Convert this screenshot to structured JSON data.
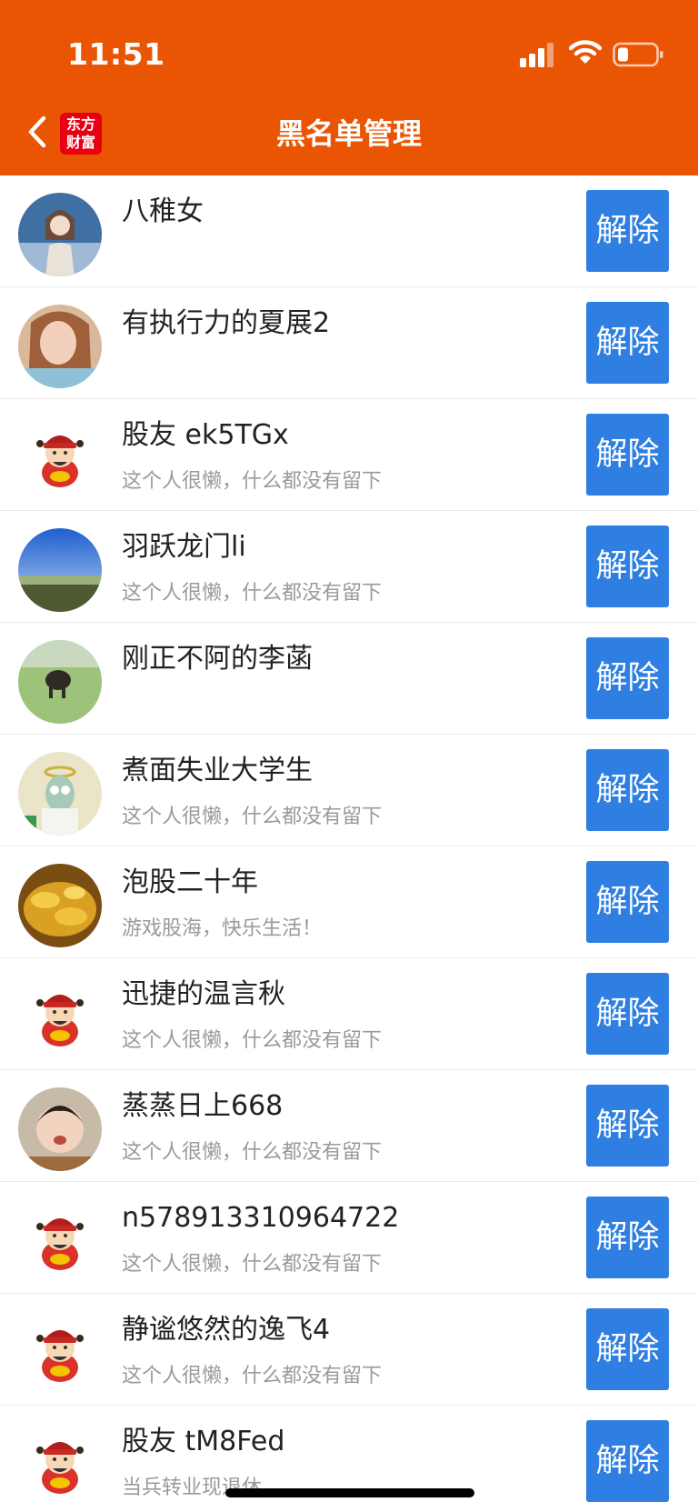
{
  "status_bar": {
    "time": "11:51"
  },
  "header": {
    "title": "黑名单管理",
    "logo_line1": "东方",
    "logo_line2": "财富"
  },
  "colors": {
    "header_bg": "#ea5504",
    "button_bg": "#2f7ee2"
  },
  "rows": [
    {
      "name": "八稚女",
      "bio": "",
      "avatar": "photo-portrait",
      "action": "解除"
    },
    {
      "name": "有执行力的夏展2",
      "bio": "",
      "avatar": "photo-selfie",
      "action": "解除"
    },
    {
      "name": "股友 ek5TGx",
      "bio": "这个人很懒，什么都没有留下",
      "avatar": "default-mascot-icon",
      "action": "解除"
    },
    {
      "name": "羽跃龙门li",
      "bio": "这个人很懒，什么都没有留下",
      "avatar": "photo-landscape",
      "action": "解除"
    },
    {
      "name": "刚正不阿的李菡",
      "bio": "",
      "avatar": "photo-buffalo",
      "action": "解除"
    },
    {
      "name": "煮面失业大学生",
      "bio": "这个人很懒，什么都没有留下",
      "avatar": "photo-cartoon",
      "action": "解除"
    },
    {
      "name": "泡股二十年",
      "bio": "游戏股海，快乐生活！",
      "avatar": "photo-gold",
      "action": "解除"
    },
    {
      "name": "迅捷的温言秋",
      "bio": "这个人很懒，什么都没有留下",
      "avatar": "default-mascot-icon",
      "action": "解除"
    },
    {
      "name": "蒸蒸日上668",
      "bio": "这个人很懒，什么都没有留下",
      "avatar": "photo-child",
      "action": "解除"
    },
    {
      "name": "n578913310964722",
      "bio": "这个人很懒，什么都没有留下",
      "avatar": "default-mascot-icon",
      "action": "解除"
    },
    {
      "name": "静谧悠然的逸飞4",
      "bio": "这个人很懒，什么都没有留下",
      "avatar": "default-mascot-icon",
      "action": "解除"
    },
    {
      "name": "股友 tM8Fed",
      "bio": "当兵转业现退休",
      "avatar": "default-mascot-icon",
      "action": "解除"
    }
  ]
}
